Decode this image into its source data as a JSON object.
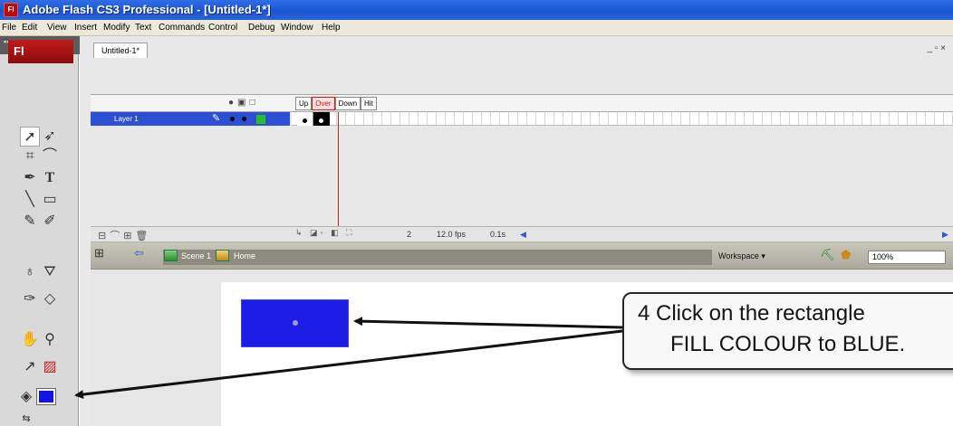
{
  "window": {
    "app_icon_text": "Fl",
    "title": "Adobe Flash CS3 Professional - [Untitled-1*]"
  },
  "menu": [
    "File",
    "Edit",
    "View",
    "Insert",
    "Modify",
    "Text",
    "Commands",
    "Control",
    "Debug",
    "Window",
    "Help"
  ],
  "tools_panel": {
    "logo": "Fl"
  },
  "document": {
    "tab_label": "Untitled-1*"
  },
  "timeline": {
    "frame_labels": [
      "Up",
      "Over",
      "Down",
      "Hit"
    ],
    "current_label": "Over",
    "layer_name": "Layer 1",
    "current_frame": "2",
    "frame_rate": "12.0 fps",
    "elapsed": "0.1s"
  },
  "edit_bar": {
    "scene": "Scene 1",
    "symbol": "Home",
    "workspace": "Workspace",
    "zoom": "100%"
  },
  "callout": {
    "line1": "4 Click on the rectangle",
    "line2": "FILL COLOUR to BLUE."
  },
  "colors": {
    "fill": "#1d1de8",
    "accent": "#e02020",
    "title_bar": "#1a54d0"
  }
}
